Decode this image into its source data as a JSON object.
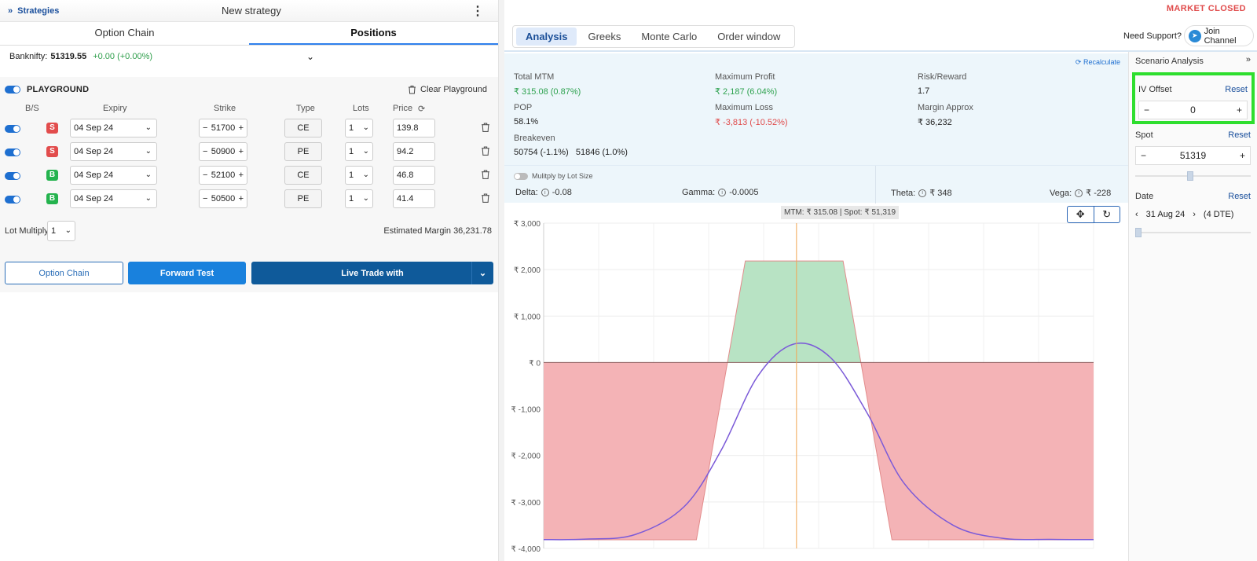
{
  "left": {
    "back_label": "Strategies",
    "strategy_name": "New strategy",
    "tabs": [
      "Option Chain",
      "Positions"
    ],
    "banknifty": {
      "label": "Banknifty:",
      "value": "51319.55",
      "change": "+0.00 (+0.00%)"
    },
    "playground": {
      "label": "PLAYGROUND",
      "clear": "Clear Playground"
    },
    "columns": [
      "B/S",
      "Expiry",
      "Strike",
      "Type",
      "Lots",
      "Price"
    ],
    "legs": [
      {
        "side": "S",
        "expiry": "04 Sep 24",
        "strike": "51700",
        "type": "CE",
        "lots": "1",
        "price": "139.8"
      },
      {
        "side": "S",
        "expiry": "04 Sep 24",
        "strike": "50900",
        "type": "PE",
        "lots": "1",
        "price": "94.2"
      },
      {
        "side": "B",
        "expiry": "04 Sep 24",
        "strike": "52100",
        "type": "CE",
        "lots": "1",
        "price": "46.8"
      },
      {
        "side": "B",
        "expiry": "04 Sep 24",
        "strike": "50500",
        "type": "PE",
        "lots": "1",
        "price": "41.4"
      }
    ],
    "lot_multiply": {
      "label": "Lot Multiply",
      "value": "1"
    },
    "estimated_margin": {
      "label": "Estimated Margin",
      "value": "36,231.78"
    },
    "buttons": {
      "option_chain": "Option Chain",
      "forward_test": "Forward Test",
      "live_trade": "Live Trade with"
    }
  },
  "right": {
    "market_status": "MARKET CLOSED",
    "tabs": [
      "Analysis",
      "Greeks",
      "Monte Carlo",
      "Order window"
    ],
    "support": "Need Support?",
    "join": "Join Channel",
    "recalculate": "Recalculate",
    "stats": {
      "total_mtm": {
        "label": "Total MTM",
        "value": "₹ 315.08 (0.87%)"
      },
      "max_profit": {
        "label": "Maximum Profit",
        "value": "₹ 2,187 (6.04%)"
      },
      "risk_reward": {
        "label": "Risk/Reward",
        "value": "1.7"
      },
      "pop": {
        "label": "POP",
        "value": "58.1%"
      },
      "max_loss": {
        "label": "Maximum Loss",
        "value": "₹ -3,813 (-10.52%)"
      },
      "margin": {
        "label": "Margin Approx",
        "value": "₹ 36,232"
      },
      "breakeven": {
        "label": "Breakeven",
        "value": "50754 (-1.1%)   51846 (1.0%)"
      }
    },
    "multiply_toggle": "Mulitply by Lot Size",
    "greeks": {
      "delta": {
        "label": "Delta:",
        "value": "-0.08"
      },
      "gamma": {
        "label": "Gamma:",
        "value": "-0.0005"
      },
      "theta": {
        "label": "Theta:",
        "value": "₹ 348"
      },
      "vega": {
        "label": "Vega:",
        "value": "₹ -228"
      }
    },
    "chart_readout": "MTM: ₹ 315.08  |  Spot: ₹ 51,319",
    "scenario": {
      "title": "Scenario Analysis",
      "iv_offset": {
        "label": "IV Offset",
        "reset": "Reset",
        "value": "0"
      },
      "spot": {
        "label": "Spot",
        "reset": "Reset",
        "value": "51319",
        "level": 0.5
      },
      "date": {
        "label": "Date",
        "reset": "Reset",
        "value": "31 Aug 24",
        "dte": "(4 DTE)",
        "level": 0.0
      }
    }
  },
  "colors": {
    "profit_fill": "#b8e3c4",
    "loss_fill": "#f4b3b6",
    "curve": "#7b5ad8",
    "spot_line": "#f2a553",
    "accent": "#1e6fd0"
  },
  "chart_data": {
    "type": "area",
    "title": "",
    "xlabel": "",
    "ylabel": "",
    "ylim": [
      -4000,
      3000
    ],
    "yticks": [
      "₹ 3,000",
      "₹ 2,000",
      "₹ 1,000",
      "₹ 0",
      "₹ -1,000",
      "₹ -2,000",
      "₹ -3,000",
      "₹ -4,000"
    ],
    "ytick_values": [
      3000,
      2000,
      1000,
      0,
      -1000,
      -2000,
      -3000,
      -4000
    ],
    "xlim": [
      49250,
      53750
    ],
    "spot": 51319,
    "series": [
      {
        "values_x": [
          49250,
          50500,
          50754,
          50900,
          51700,
          51846,
          52100,
          53750
        ],
        "values_y": [
          -3813,
          -3813,
          0,
          2187,
          2187,
          0,
          -3813,
          -3813
        ]
      },
      {
        "values_x": [
          49250,
          49600,
          50000,
          50400,
          50700,
          51000,
          51300,
          51600,
          51900,
          52200,
          52600,
          53000,
          53400,
          53750
        ],
        "values_y": [
          -3810,
          -3800,
          -3700,
          -3100,
          -1900,
          -300,
          400,
          100,
          -1100,
          -2600,
          -3500,
          -3780,
          -3805,
          -3810
        ]
      }
    ]
  }
}
